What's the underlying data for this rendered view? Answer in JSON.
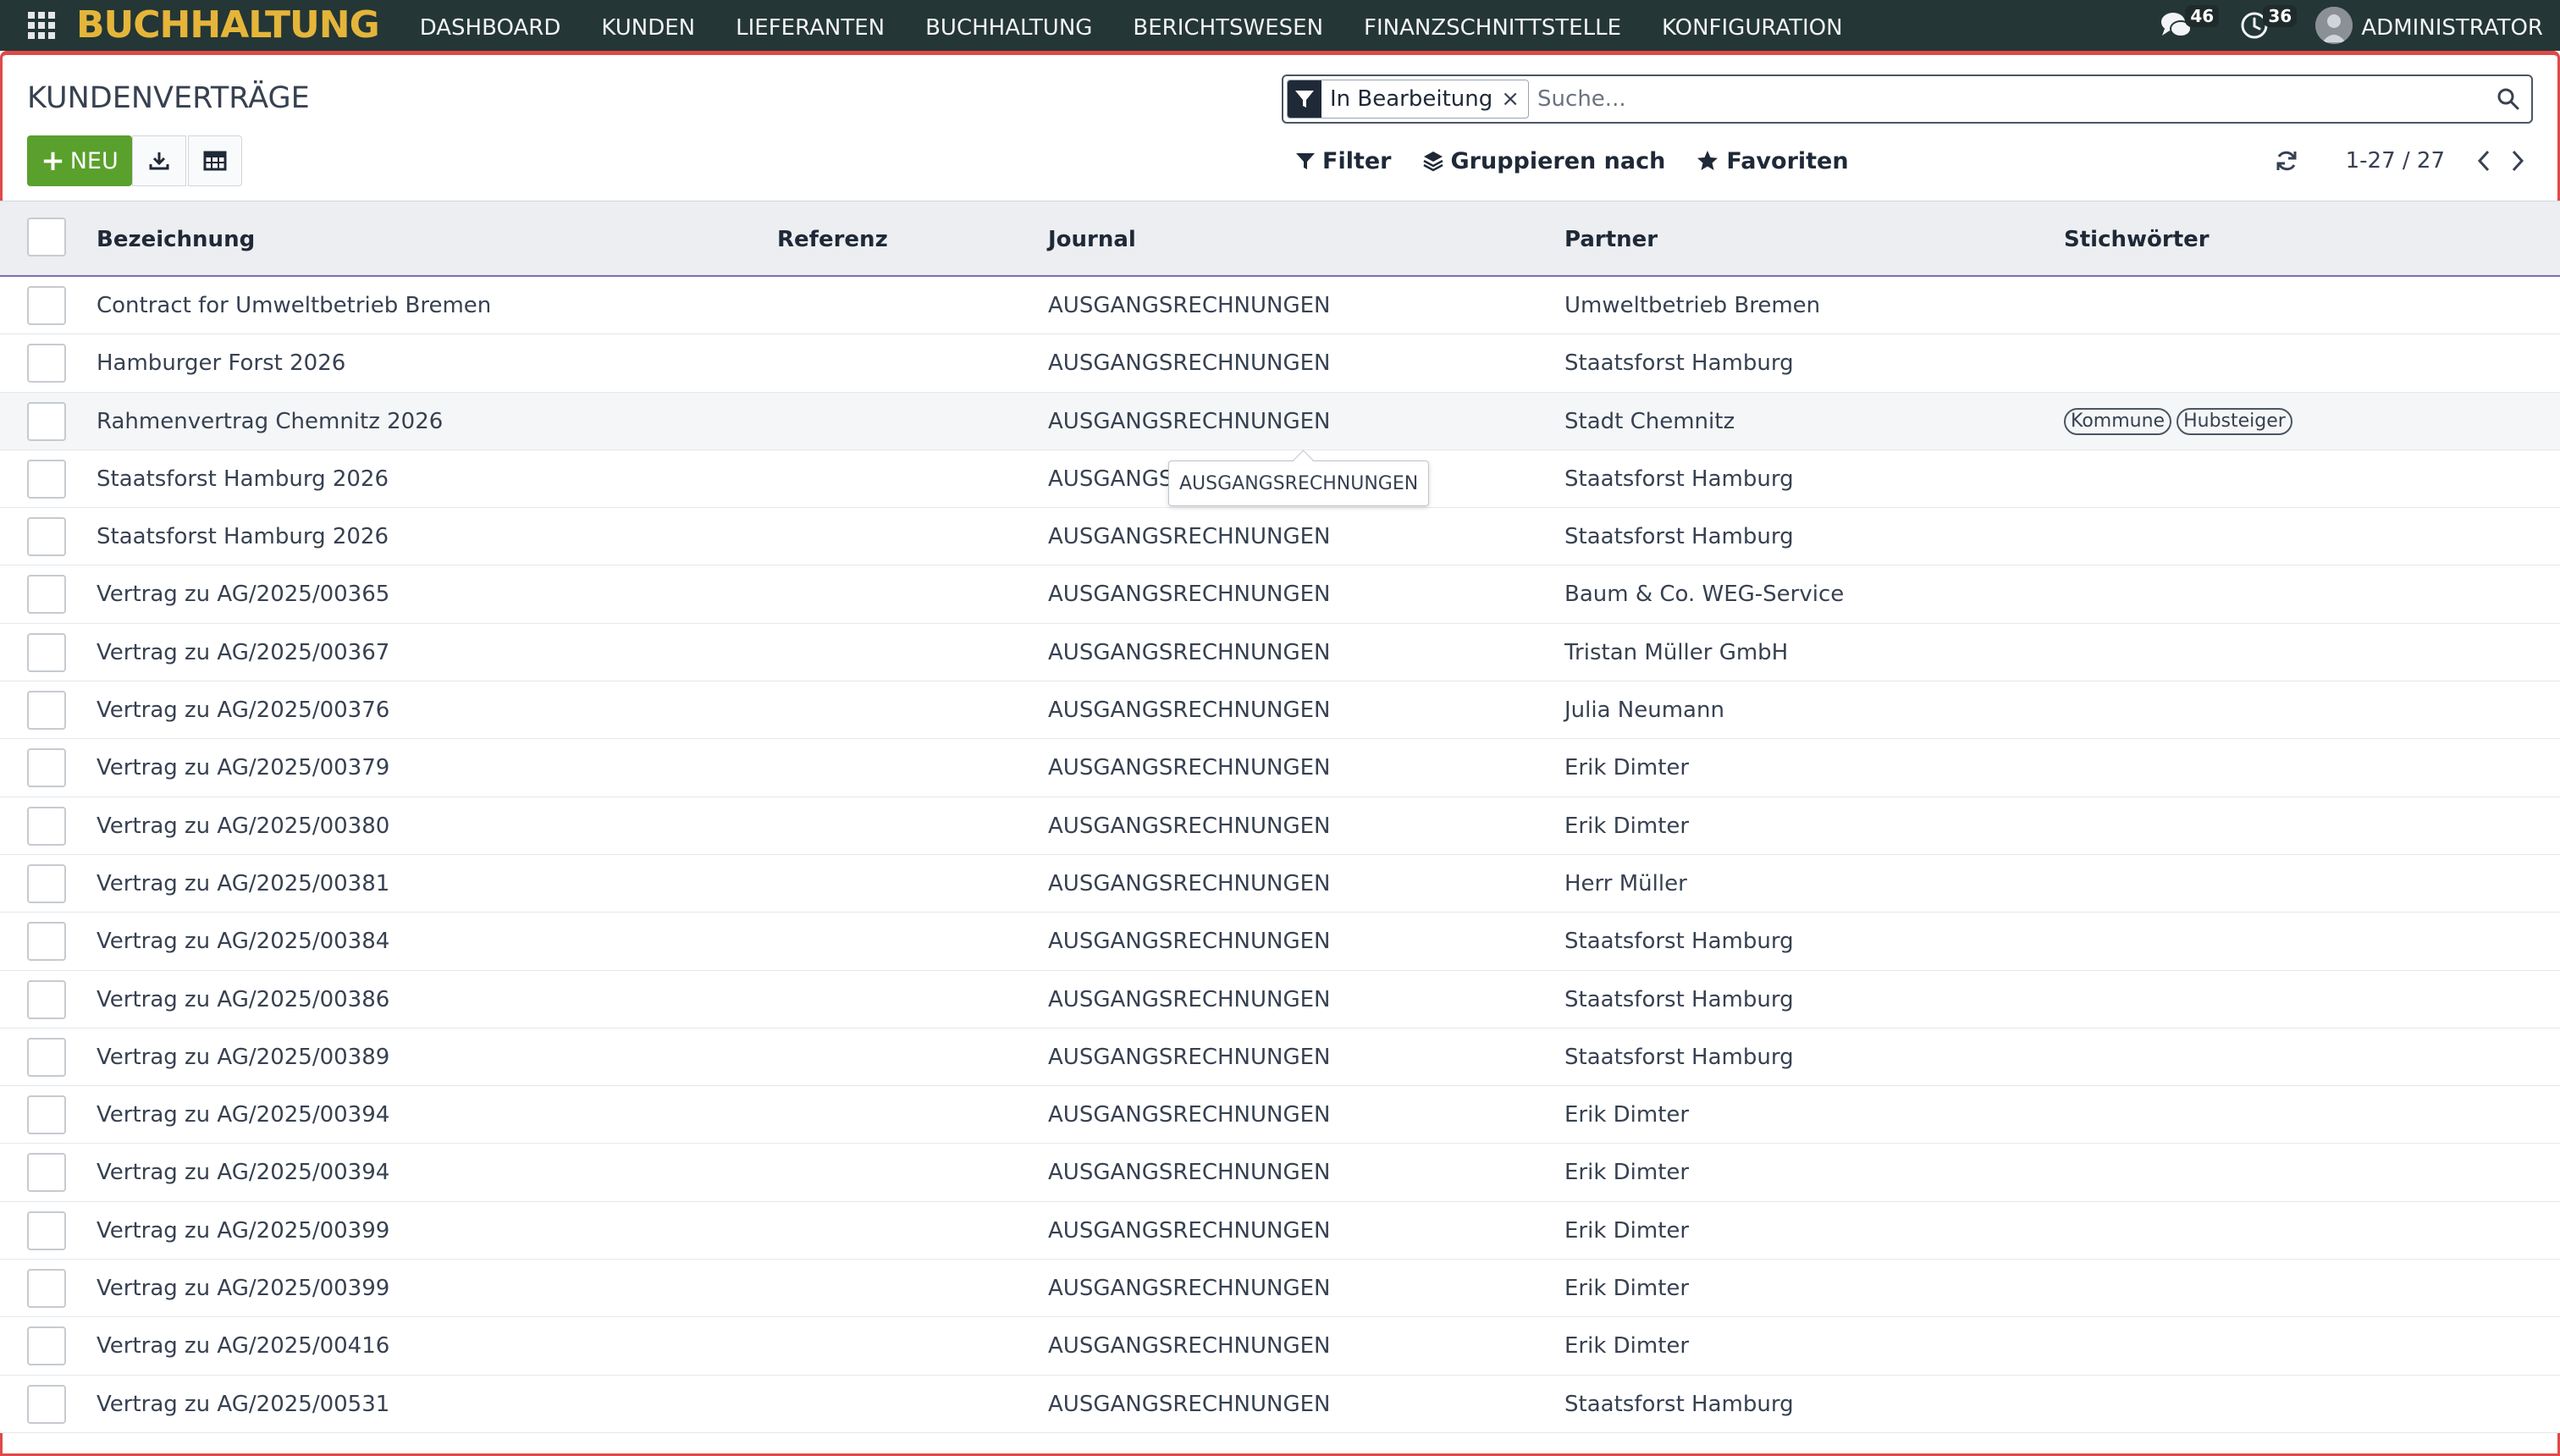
{
  "navbar": {
    "brand": "BUCHHALTUNG",
    "menu": [
      "DASHBOARD",
      "KUNDEN",
      "LIEFERANTEN",
      "BUCHHALTUNG",
      "BERICHTSWESEN",
      "FINANZSCHNITTSTELLE",
      "KONFIGURATION"
    ],
    "messages_count": "46",
    "activities_count": "36",
    "user": "ADMINISTRATOR"
  },
  "page": {
    "title": "KUNDENVERTRÄGE",
    "new_label": "NEU"
  },
  "search": {
    "facet": "In Bearbeitung",
    "facet_remove": "×",
    "placeholder": "Suche..."
  },
  "toolbar": {
    "filter": "Filter",
    "group_by": "Gruppieren nach",
    "favorites": "Favoriten"
  },
  "pager": {
    "value": "1-27 / 27"
  },
  "table": {
    "columns": [
      "Bezeichnung",
      "Referenz",
      "Journal",
      "Partner",
      "Stichwörter"
    ],
    "rows": [
      {
        "name": "Contract for Umweltbetrieb Bremen",
        "ref": "",
        "journal": "AUSGANGSRECHNUNGEN",
        "partner": "Umweltbetrieb Bremen",
        "tags": []
      },
      {
        "name": "Hamburger Forst 2026",
        "ref": "",
        "journal": "AUSGANGSRECHNUNGEN",
        "partner": "Staatsforst Hamburg",
        "tags": []
      },
      {
        "name": "Rahmenvertrag Chemnitz 2026",
        "ref": "",
        "journal": "AUSGANGSRECHNUNGEN",
        "partner": "Stadt Chemnitz",
        "tags": [
          "Kommune",
          "Hubsteiger"
        ]
      },
      {
        "name": "Staatsforst Hamburg 2026",
        "ref": "",
        "journal": "AUSGANGSRECHNUNGEN",
        "partner": "Staatsforst Hamburg",
        "tags": []
      },
      {
        "name": "Staatsforst Hamburg 2026",
        "ref": "",
        "journal": "AUSGANGSRECHNUNGEN",
        "partner": "Staatsforst Hamburg",
        "tags": []
      },
      {
        "name": "Vertrag zu AG/2025/00365",
        "ref": "",
        "journal": "AUSGANGSRECHNUNGEN",
        "partner": "Baum & Co. WEG-Service",
        "tags": []
      },
      {
        "name": "Vertrag zu AG/2025/00367",
        "ref": "",
        "journal": "AUSGANGSRECHNUNGEN",
        "partner": "Tristan Müller GmbH",
        "tags": []
      },
      {
        "name": "Vertrag zu AG/2025/00376",
        "ref": "",
        "journal": "AUSGANGSRECHNUNGEN",
        "partner": "Julia Neumann",
        "tags": []
      },
      {
        "name": "Vertrag zu AG/2025/00379",
        "ref": "",
        "journal": "AUSGANGSRECHNUNGEN",
        "partner": "Erik Dimter",
        "tags": []
      },
      {
        "name": "Vertrag zu AG/2025/00380",
        "ref": "",
        "journal": "AUSGANGSRECHNUNGEN",
        "partner": "Erik Dimter",
        "tags": []
      },
      {
        "name": "Vertrag zu AG/2025/00381",
        "ref": "",
        "journal": "AUSGANGSRECHNUNGEN",
        "partner": "Herr Müller",
        "tags": []
      },
      {
        "name": "Vertrag zu AG/2025/00384",
        "ref": "",
        "journal": "AUSGANGSRECHNUNGEN",
        "partner": "Staatsforst Hamburg",
        "tags": []
      },
      {
        "name": "Vertrag zu AG/2025/00386",
        "ref": "",
        "journal": "AUSGANGSRECHNUNGEN",
        "partner": "Staatsforst Hamburg",
        "tags": []
      },
      {
        "name": "Vertrag zu AG/2025/00389",
        "ref": "",
        "journal": "AUSGANGSRECHNUNGEN",
        "partner": "Staatsforst Hamburg",
        "tags": []
      },
      {
        "name": "Vertrag zu AG/2025/00394",
        "ref": "",
        "journal": "AUSGANGSRECHNUNGEN",
        "partner": "Erik Dimter",
        "tags": []
      },
      {
        "name": "Vertrag zu AG/2025/00394",
        "ref": "",
        "journal": "AUSGANGSRECHNUNGEN",
        "partner": "Erik Dimter",
        "tags": []
      },
      {
        "name": "Vertrag zu AG/2025/00399",
        "ref": "",
        "journal": "AUSGANGSRECHNUNGEN",
        "partner": "Erik Dimter",
        "tags": []
      },
      {
        "name": "Vertrag zu AG/2025/00399",
        "ref": "",
        "journal": "AUSGANGSRECHNUNGEN",
        "partner": "Erik Dimter",
        "tags": []
      },
      {
        "name": "Vertrag zu AG/2025/00416",
        "ref": "",
        "journal": "AUSGANGSRECHNUNGEN",
        "partner": "Erik Dimter",
        "tags": []
      },
      {
        "name": "Vertrag zu AG/2025/00531",
        "ref": "",
        "journal": "AUSGANGSRECHNUNGEN",
        "partner": "Staatsforst Hamburg",
        "tags": []
      }
    ]
  },
  "tooltip": {
    "text": "AUSGANGSRECHNUNGEN"
  },
  "colors": {
    "navbar_bg": "#243635",
    "brand": "#e5b53a",
    "primary_button": "#5aa02c",
    "frame_border": "#e04848"
  }
}
